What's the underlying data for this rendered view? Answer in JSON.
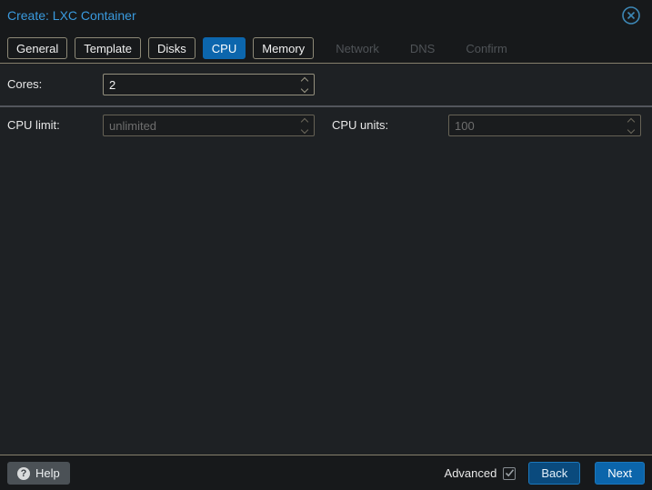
{
  "window": {
    "title": "Create: LXC Container"
  },
  "tabs": [
    {
      "label": "General",
      "state": "normal"
    },
    {
      "label": "Template",
      "state": "normal"
    },
    {
      "label": "Disks",
      "state": "normal"
    },
    {
      "label": "CPU",
      "state": "active"
    },
    {
      "label": "Memory",
      "state": "normal"
    },
    {
      "label": "Network",
      "state": "disabled"
    },
    {
      "label": "DNS",
      "state": "disabled"
    },
    {
      "label": "Confirm",
      "state": "disabled"
    }
  ],
  "form": {
    "fields": [
      {
        "label": "Cores:",
        "value": "2",
        "disabled": false
      },
      {
        "label": "CPU limit:",
        "value": "unlimited",
        "disabled": true
      },
      {
        "label": "CPU units:",
        "value": "100",
        "disabled": true
      }
    ]
  },
  "footer": {
    "help_label": "Help",
    "help_icon": "?",
    "advanced_label": "Advanced",
    "advanced_checked": true,
    "back_label": "Back",
    "next_label": "Next"
  },
  "colors": {
    "accent_blue": "#0c66ad",
    "title_blue": "#3a9ade",
    "close_icon_blue": "#3d87b5",
    "tab_border_tan": "#8d8977",
    "disabled_text": "#6e6e6e",
    "panel_bg": "#1e2124",
    "header_bg": "#17191b"
  }
}
